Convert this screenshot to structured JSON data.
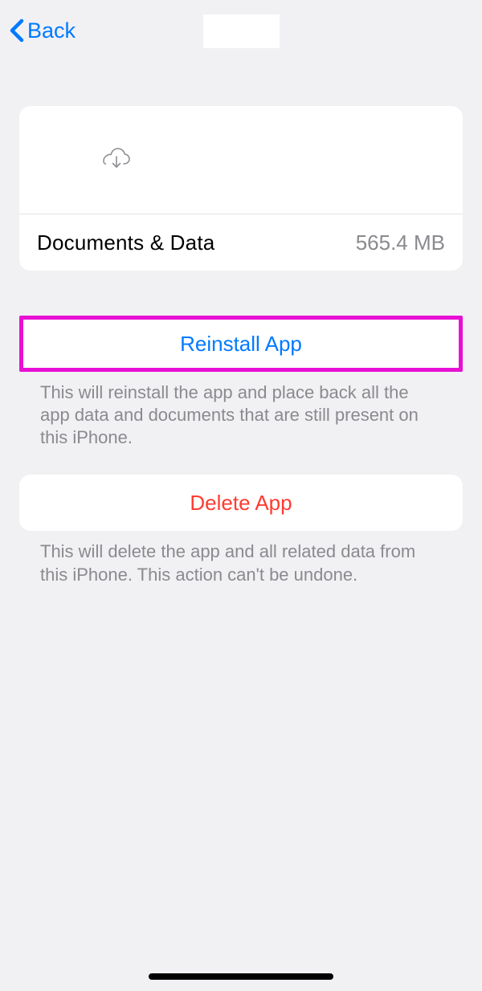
{
  "nav": {
    "back_label": "Back"
  },
  "storage": {
    "documents_label": "Documents & Data",
    "documents_value": "565.4 MB"
  },
  "reinstall": {
    "button_label": "Reinstall App",
    "description": "This will reinstall the app and place back all the app data and documents that are still present on this iPhone."
  },
  "delete": {
    "button_label": "Delete App",
    "description": "This will delete the app and all related data from this iPhone. This action can't be undone."
  },
  "icons": {
    "cloud": "cloud-download-icon",
    "back": "chevron-left-icon"
  }
}
